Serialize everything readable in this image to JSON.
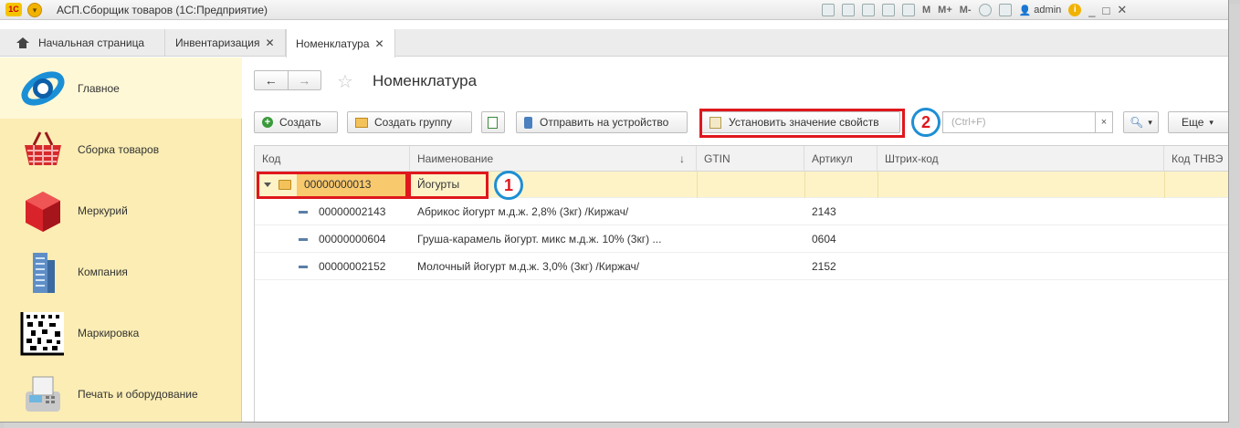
{
  "titlebar": {
    "app_logo": "1С",
    "title": "АСП.Сборщик товаров  (1С:Предприятие)",
    "m_labels": [
      "M",
      "M+",
      "M-"
    ],
    "user": "admin",
    "icons": [
      "save-icon",
      "print-icon",
      "preview-icon",
      "calculator-icon",
      "calendar-icon",
      "search-icon",
      "info-icon"
    ],
    "window_controls": [
      "_",
      "□",
      "✕"
    ]
  },
  "tabs": [
    {
      "label": "Начальная страница",
      "closable": false
    },
    {
      "label": "Инвентаризация",
      "closable": true
    },
    {
      "label": "Номенклатура",
      "closable": true,
      "active": true
    }
  ],
  "sidebar": {
    "items": [
      {
        "label": "Главное",
        "icon": "main-globe-icon",
        "active": true
      },
      {
        "label": "Сборка товаров",
        "icon": "basket-icon"
      },
      {
        "label": "Меркурий",
        "icon": "red-cube-icon"
      },
      {
        "label": "Компания",
        "icon": "building-icon"
      },
      {
        "label": "Маркировка",
        "icon": "datamatrix-icon"
      },
      {
        "label": "Печать и оборудование",
        "icon": "payment-terminal-icon"
      }
    ]
  },
  "page": {
    "title": "Номенклатура",
    "nav_back": "←",
    "nav_forward": "→"
  },
  "toolbar": {
    "create": "Создать",
    "create_group": "Создать группу",
    "send_device": "Отправить на устройство",
    "set_property": "Установить значение свойств",
    "search_placeholder": "(Ctrl+F)",
    "clear": "×",
    "more": "Еще"
  },
  "annotations": {
    "label_1": "1",
    "label_2": "2",
    "box_color": "#e0171d",
    "circle_color": "#1f8fd4"
  },
  "table": {
    "columns": [
      "Код",
      "Наименование",
      "GTIN",
      "Артикул",
      "Штрих-код",
      "Код ТНВЭ"
    ],
    "sorted_column_marker": "↓",
    "group_row": {
      "code": "00000000013",
      "name": "Йогурты"
    },
    "rows": [
      {
        "code": "00000002143",
        "name": "Абрикос йогурт м.д.ж. 2,8% (3кг) /Киржач/",
        "gtin": "",
        "article": "2143",
        "barcode": "",
        "tnved": ""
      },
      {
        "code": "00000000604",
        "name": "Груша-карамель йогурт. микс м.д.ж. 10% (3кг) ...",
        "gtin": "",
        "article": "0604",
        "barcode": "",
        "tnved": ""
      },
      {
        "code": "00000002152",
        "name": "Молочный йогурт м.д.ж. 3,0% (3кг) /Киржач/",
        "gtin": "",
        "article": "2152",
        "barcode": "",
        "tnved": ""
      }
    ]
  }
}
